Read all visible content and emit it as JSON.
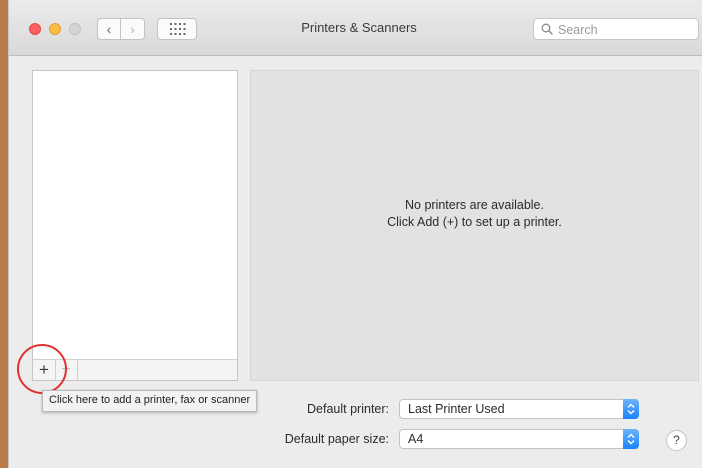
{
  "window": {
    "title": "Printers & Scanners",
    "traffic_lights": [
      "close",
      "minimize",
      "zoom"
    ]
  },
  "toolbar": {
    "back_glyph": "‹",
    "forward_glyph": "›",
    "show_all_icon": "grid-icon",
    "search_placeholder": "Search"
  },
  "printer_list": {
    "items": [],
    "add_label": "+",
    "remove_label": "−"
  },
  "tooltip": {
    "text": "Click here to add a printer, fax or scanner"
  },
  "details": {
    "line1": "No printers are available.",
    "line2": "Click Add (+) to set up a printer."
  },
  "settings": {
    "default_printer_label": "Default printer:",
    "default_printer_value": "Last Printer Used",
    "default_paper_label": "Default paper size:",
    "default_paper_value": "A4"
  },
  "help": {
    "label": "?"
  },
  "colors": {
    "accent": "#1a82fb",
    "highlight_ring": "#e0332f",
    "close": "#fc605c",
    "minimize": "#fdbc40",
    "zoom_inactive": "#d4d4d4"
  }
}
